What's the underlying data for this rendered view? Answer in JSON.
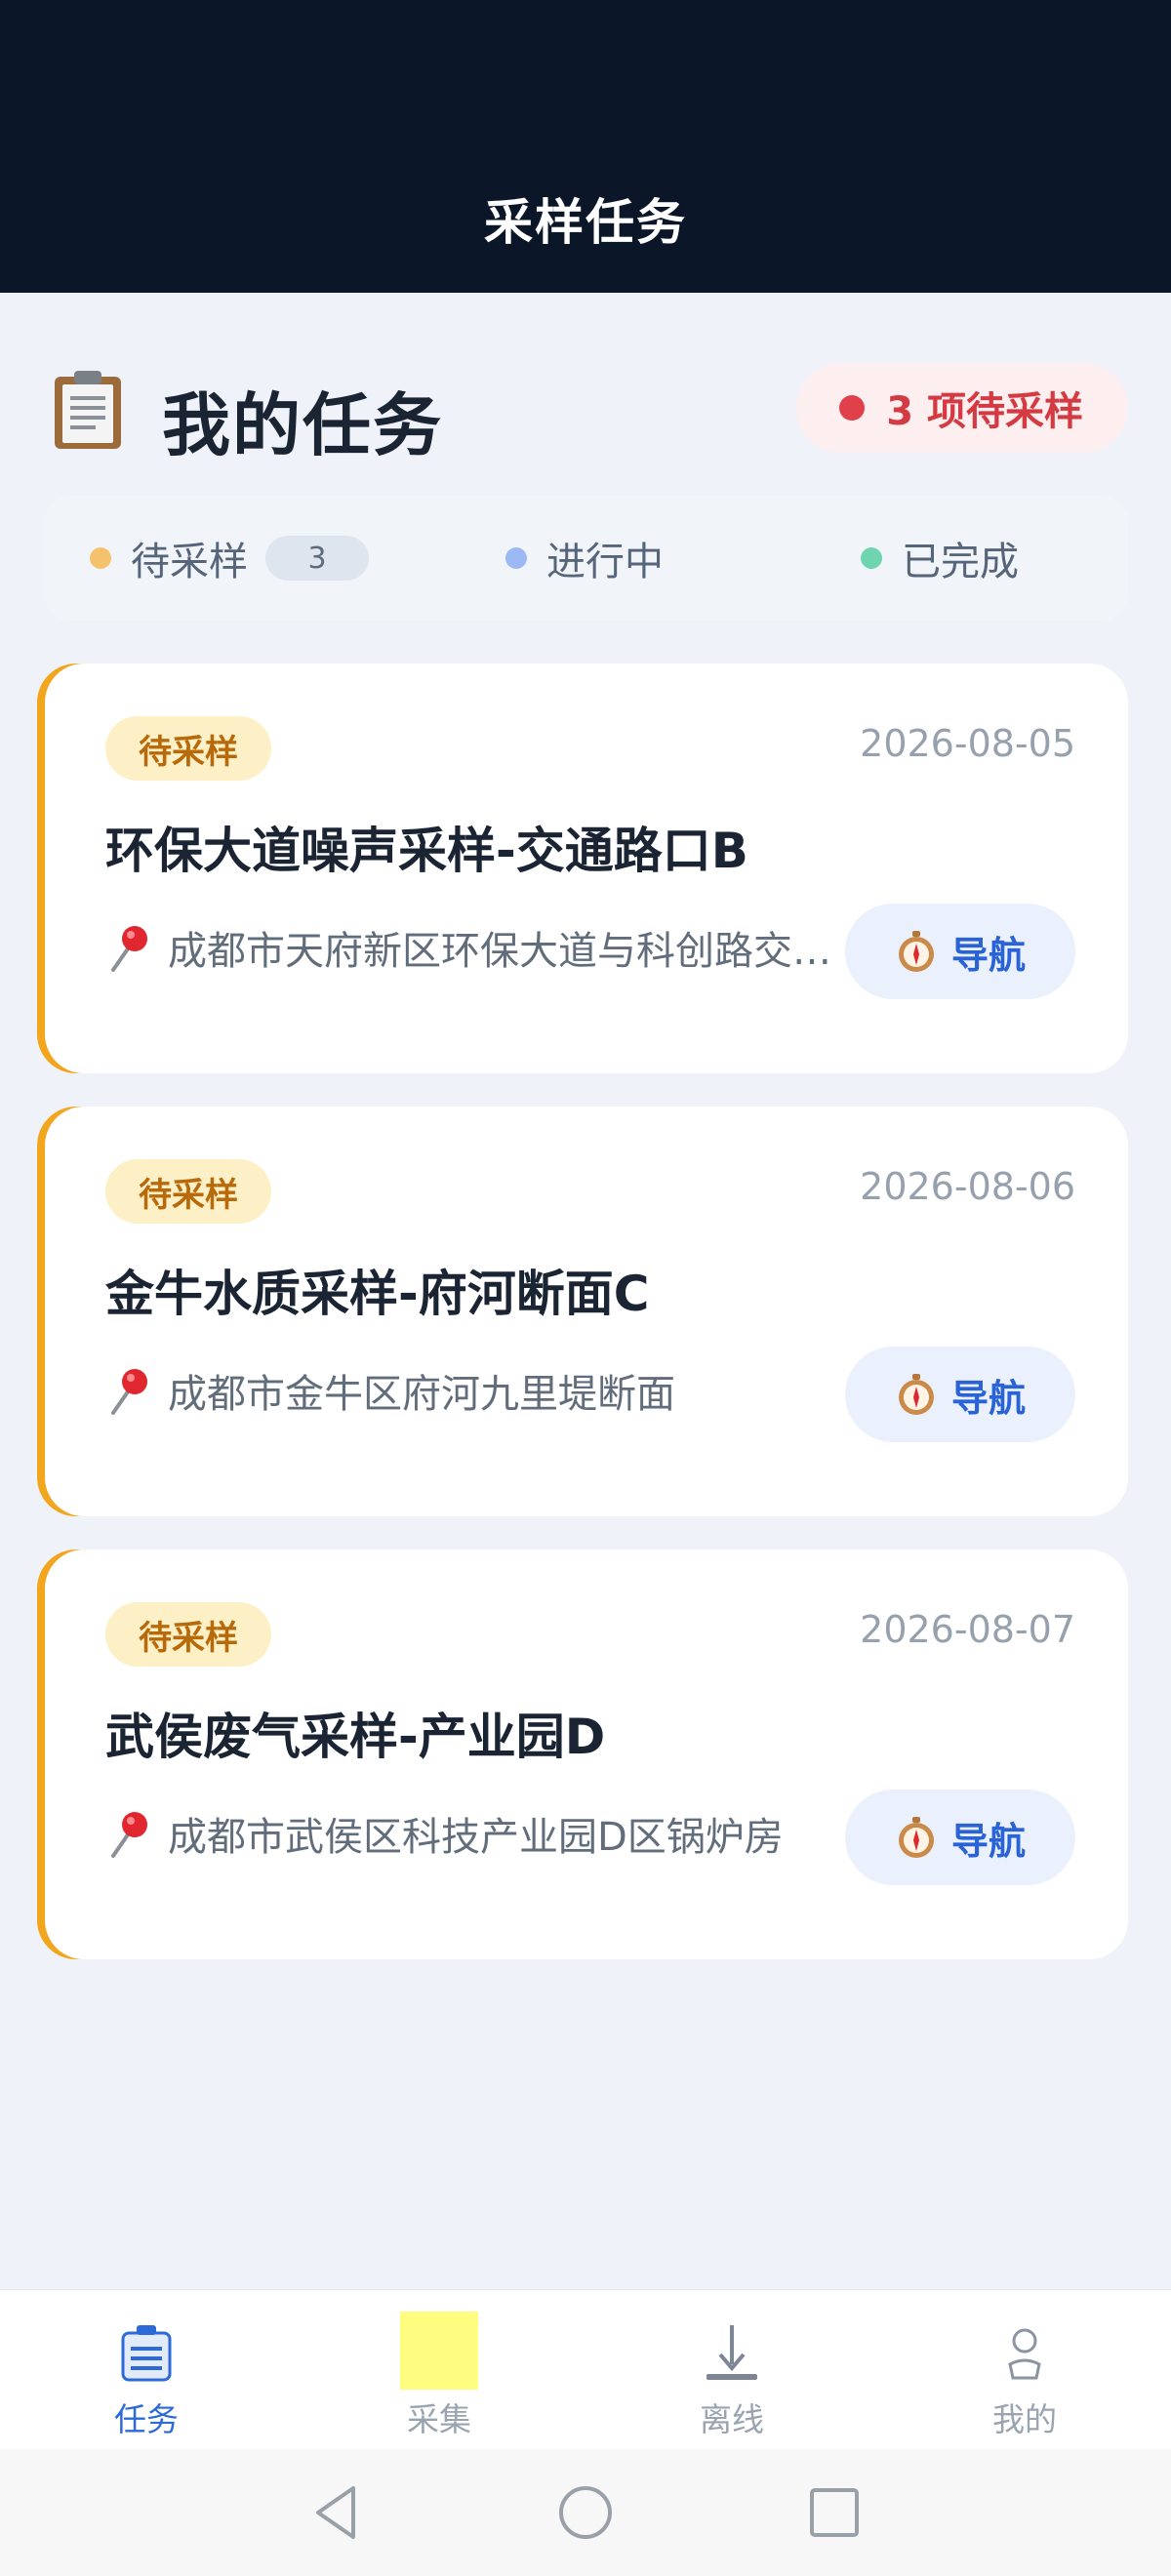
{
  "header": {
    "title": "采样任务"
  },
  "section": {
    "title": "我的任务",
    "icon": "clipboard-icon",
    "pending_text": "3 项待采样",
    "pending_color": "#e0404a"
  },
  "filters": [
    {
      "label": "待采样",
      "count": "3",
      "dot_color": "#f5c26b"
    },
    {
      "label": "进行中",
      "dot_color": "#9cb8f5"
    },
    {
      "label": "已完成",
      "dot_color": "#6fd4b0"
    }
  ],
  "tasks": [
    {
      "status": "待采样",
      "date": "2026-08-05",
      "title": "环保大道噪声采样-交通路口B",
      "address": "成都市天府新区环保大道与科创路交叉口",
      "nav_label": "导航"
    },
    {
      "status": "待采样",
      "date": "2026-08-06",
      "title": "金牛水质采样-府河断面C",
      "address": "成都市金牛区府河九里堤断面",
      "nav_label": "导航"
    },
    {
      "status": "待采样",
      "date": "2026-08-07",
      "title": "武侯废气采样-产业园D",
      "address": "成都市武侯区科技产业园D区锅炉房",
      "nav_label": "导航"
    }
  ],
  "tabbar": [
    {
      "label": "任务",
      "icon": "task-list-icon",
      "active": true
    },
    {
      "label": "采集",
      "icon": "collect-icon",
      "active": false
    },
    {
      "label": "离线",
      "icon": "download-icon",
      "active": false
    },
    {
      "label": "我的",
      "icon": "profile-icon",
      "active": false
    }
  ],
  "colors": {
    "header_bg": "#0c1629",
    "accent_blue": "#2d6ad9",
    "status_orange": "#f2a61d",
    "page_bg": "#eff2f9"
  }
}
